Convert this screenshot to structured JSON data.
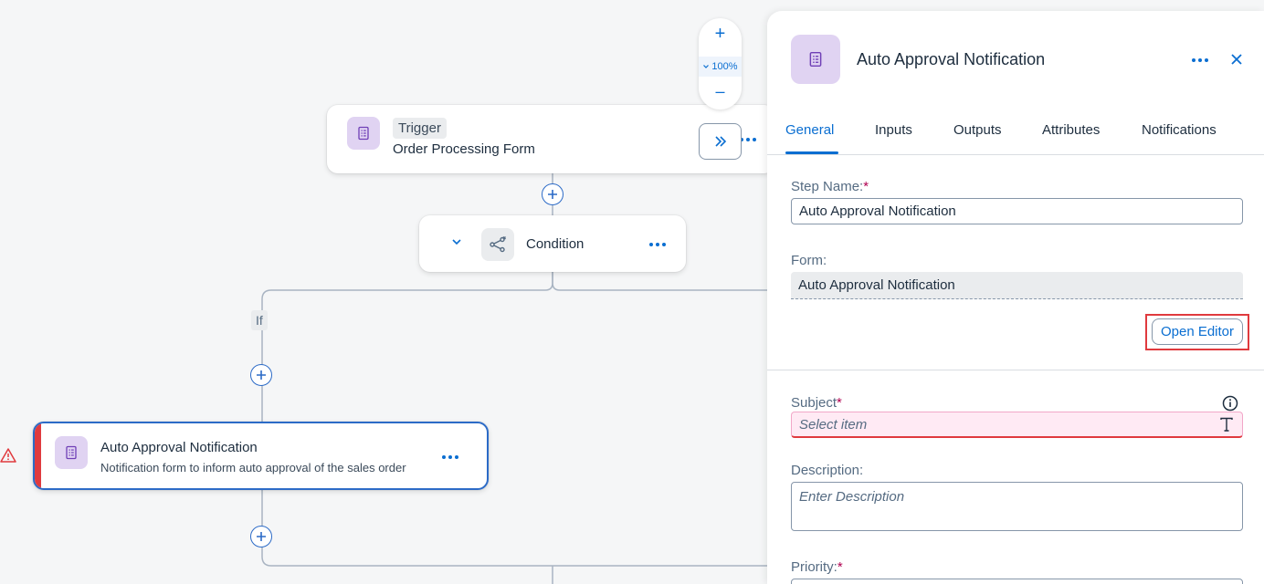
{
  "canvas": {
    "zoom": {
      "plus": "+",
      "minus": "–",
      "level": "100%"
    },
    "trigger": {
      "tag": "Trigger",
      "title": "Order Processing Form"
    },
    "condition": {
      "title": "Condition"
    },
    "branch_label": "If",
    "step": {
      "title": "Auto Approval Notification",
      "description": "Notification form to inform auto approval of the sales order"
    }
  },
  "panel": {
    "title": "Auto Approval Notification",
    "tabs": [
      "General",
      "Inputs",
      "Outputs",
      "Attributes",
      "Notifications"
    ],
    "active_tab": "General",
    "step_name": {
      "label": "Step Name:",
      "required": "*",
      "value": "Auto Approval Notification"
    },
    "form": {
      "label": "Form:",
      "value": "Auto Approval Notification"
    },
    "open_editor": "Open Editor",
    "subject": {
      "label": "Subject",
      "required": "*",
      "placeholder": "Select item"
    },
    "description": {
      "label": "Description:",
      "placeholder": "Enter Description"
    },
    "priority": {
      "label": "Priority:",
      "required": "*"
    }
  },
  "colors": {
    "accent": "#0a6ed1",
    "icon_bg": "#e0d3f2",
    "error": "#e03a3e",
    "required": "#b00050"
  }
}
